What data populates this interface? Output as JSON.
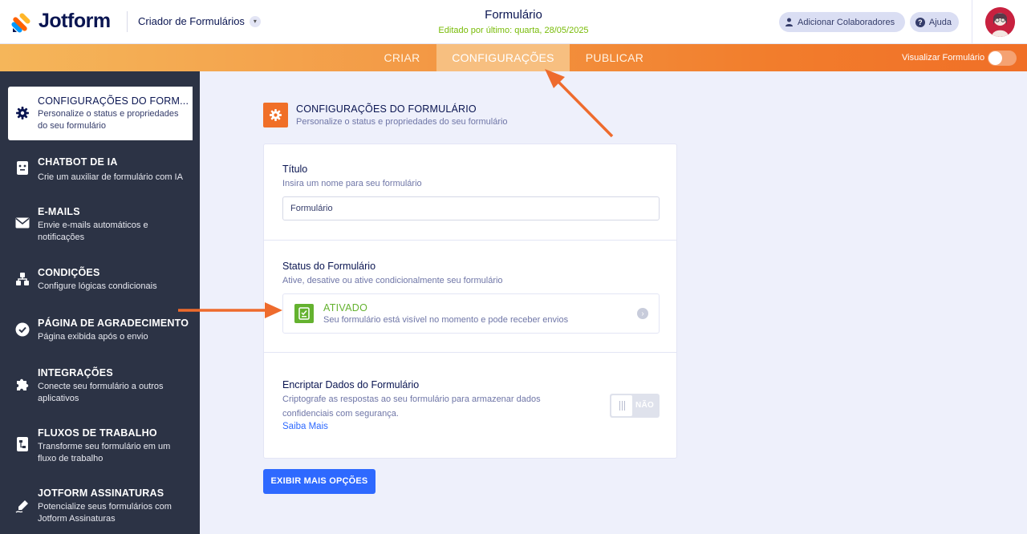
{
  "header": {
    "brand": "Jotform",
    "builder_label": "Criador de Formulários",
    "form_title": "Formulário",
    "edited_text": "Editado por último: quarta, 28/05/2025",
    "collab_button": "Adicionar Colaboradores",
    "help_button": "Ajuda"
  },
  "nav": {
    "tabs": [
      "CRIAR",
      "CONFIGURAÇÕES",
      "PUBLICAR"
    ],
    "active_tab": "CONFIGURAÇÕES",
    "preview_label": "Visualizar Formulário",
    "preview_on": false
  },
  "sidebar": {
    "items": [
      {
        "title": "CONFIGURAÇÕES DO FORM...",
        "desc": "Personalize o status e propriedades do seu formulário",
        "icon": "gear-icon",
        "active": true
      },
      {
        "title": "CHATBOT DE IA",
        "desc": "Crie um auxiliar de formulário com IA",
        "icon": "chatbot-icon"
      },
      {
        "title": "E-MAILS",
        "desc": "Envie e-mails automáticos e notificações",
        "icon": "envelope-icon"
      },
      {
        "title": "CONDIÇÕES",
        "desc": "Configure lógicas condicionais",
        "icon": "conditions-icon"
      },
      {
        "title": "PÁGINA DE AGRADECIMENTO",
        "desc": "Página exibida após o envio",
        "icon": "check-circle-icon"
      },
      {
        "title": "INTEGRAÇÕES",
        "desc": "Conecte seu formulário a outros aplicativos",
        "icon": "puzzle-icon"
      },
      {
        "title": "FLUXOS DE TRABALHO",
        "desc": "Transforme seu formulário em um fluxo de trabalho",
        "icon": "workflow-icon"
      },
      {
        "title": "JOTFORM ASSINATURAS",
        "desc": "Potencialize seus formulários com Jotform Assinaturas",
        "icon": "signature-pen-icon"
      }
    ]
  },
  "main": {
    "section_title": "CONFIGURAÇÕES DO FORMULÁRIO",
    "section_subtitle": "Personalize o status e propriedades do seu formulário",
    "title_field": {
      "label": "Título",
      "hint": "Insira um nome para seu formulário",
      "value": "Formulário"
    },
    "status": {
      "label": "Status do Formulário",
      "hint": "Ative, desative ou ative condicionalmente seu formulário",
      "state_title": "ATIVADO",
      "state_desc": "Seu formulário está visível no momento e pode receber envios"
    },
    "encrypt": {
      "label": "Encriptar Dados do Formulário",
      "desc": "Criptografe as respostas ao seu formulário para armazenar dados confidenciais com segurança.",
      "link": "Saiba Mais",
      "toggle_label": "NÃO"
    },
    "more_button": "EXIBIR MAIS OPÇÕES"
  },
  "colors": {
    "accent_orange": "#f06f27",
    "status_green": "#64b22f",
    "primary_blue": "#2e69ff",
    "sidebar_bg": "#2c3345"
  }
}
